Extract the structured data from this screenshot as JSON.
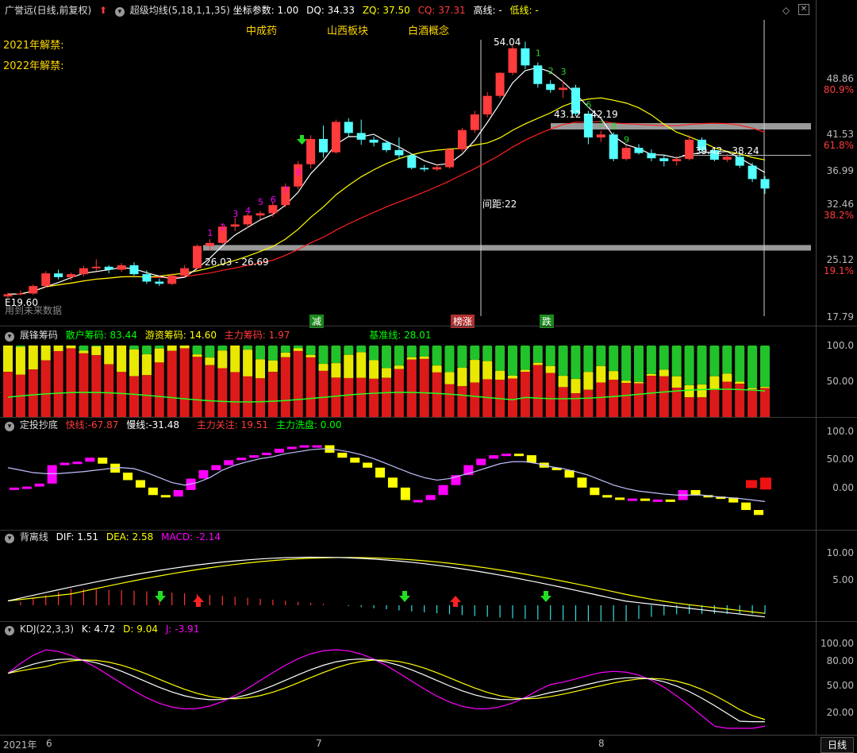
{
  "panel_main": {
    "title": "广誉远(日线,前复权)",
    "indicator_name": "超级均线",
    "indicator_params": "(5,18,1,1,35)",
    "coord_label": "坐标参数:",
    "coord_val": "1.00",
    "dq_label": "DQ:",
    "dq_val": "34.33",
    "zq_label": "ZQ:",
    "zq_val": "37.50",
    "cq_label": "CQ:",
    "cq_val": "37.31",
    "high_label": "高线:",
    "high_val": "-",
    "low_label": "低线:",
    "low_val": "-",
    "concepts": [
      "中成药",
      "山西板块",
      "白酒概念"
    ],
    "unlock_2021": "2021年解禁:",
    "unlock_2022": "2022年解禁:",
    "annot_peak": "54.04",
    "annot_band1": "43.12 - 42.19",
    "annot_band2": "39.42 - 38.24",
    "annot_band3": "26.03 - 26.69",
    "annot_low": "19.60",
    "annot_spacing": "间距:22",
    "annot_future": "用到未来数据",
    "tag_reduce": "减",
    "tag_list": "榜涨",
    "tag_fall": "跌",
    "yticks": [
      "48.86",
      "80.9%",
      "41.53",
      "61.8%",
      "36.99",
      "32.46",
      "38.2%",
      "25.12",
      "19.1%",
      "17.79"
    ]
  },
  "panel_chip": {
    "title": "展锋筹码",
    "retail_label": "散户筹码:",
    "retail_val": "83.44",
    "hot_label": "游资筹码:",
    "hot_val": "14.60",
    "main_label": "主力筹码:",
    "main_val": "1.97",
    "base_label": "基准线:",
    "base_val": "28.01",
    "yticks": [
      "100.0",
      "50.00"
    ]
  },
  "panel_dt": {
    "title": "定投抄底",
    "fast_label": "快线:",
    "fast_val": "-67.87",
    "slow_label": "慢线:",
    "slow_val": "-31.48",
    "focus_label": "主力关注:",
    "focus_val": "19.51",
    "wash_label": "主力洗盘:",
    "wash_val": "0.00",
    "yticks": [
      "100.0",
      "50.00",
      "0.00"
    ]
  },
  "panel_macd": {
    "title": "背离线",
    "dif_label": "DIF:",
    "dif_val": "1.51",
    "dea_label": "DEA:",
    "dea_val": "2.58",
    "macd_label": "MACD:",
    "macd_val": "-2.14",
    "yticks": [
      "10.00",
      "5.00"
    ]
  },
  "panel_kdj": {
    "title": "KDJ(22,3,3)",
    "k_label": "K:",
    "k_val": "4.72",
    "d_label": "D:",
    "d_val": "9.04",
    "j_label": "J:",
    "j_val": "-3.91",
    "yticks": [
      "100.00",
      "80.00",
      "50.00",
      "20.00"
    ]
  },
  "xaxis": {
    "labels": [
      "2021年",
      "6",
      "7",
      "8"
    ],
    "period_button": "日线"
  },
  "colors": {
    "up": "#ff3b3b",
    "down": "#54ffff",
    "ma_fast": "#ffffff",
    "ma_mid": "#ffff00",
    "ma_slow": "#ff2020",
    "purple": "#ff00ff",
    "green": "#00ff00"
  },
  "chart_data": {
    "type": "candlestick",
    "note_series": [
      "close",
      "ma_fast",
      "ma_mid",
      "ma_slow"
    ],
    "x": [
      "d1",
      "d2",
      "d3",
      "d4",
      "d5",
      "d6",
      "d7",
      "d8",
      "d9",
      "d10",
      "d11",
      "d12",
      "d13",
      "d14",
      "d15",
      "d16",
      "d17",
      "d18",
      "d19",
      "d20",
      "d21",
      "d22",
      "d23",
      "d24",
      "d25",
      "d26",
      "d27",
      "d28",
      "d29",
      "d30",
      "d31",
      "d32",
      "d33",
      "d34",
      "d35",
      "d36",
      "d37",
      "d38",
      "d39",
      "d40",
      "d41",
      "d42",
      "d43",
      "d44",
      "d45",
      "d46",
      "d47",
      "d48",
      "d49",
      "d50",
      "d51",
      "d52",
      "d53",
      "d54",
      "d55",
      "d56",
      "d57",
      "d58",
      "d59",
      "d60",
      "d61"
    ],
    "ohlc": [
      [
        19.8,
        20.3,
        19.6,
        20.1
      ],
      [
        20.1,
        20.6,
        19.9,
        20.2
      ],
      [
        20.2,
        21.4,
        20.0,
        21.2
      ],
      [
        21.2,
        23.2,
        21.0,
        22.9
      ],
      [
        22.9,
        23.4,
        22.1,
        22.4
      ],
      [
        22.4,
        23.0,
        22.0,
        22.8
      ],
      [
        22.8,
        23.9,
        22.5,
        23.6
      ],
      [
        23.6,
        24.8,
        23.2,
        23.8
      ],
      [
        23.8,
        24.0,
        22.9,
        23.4
      ],
      [
        23.4,
        24.3,
        23.1,
        24.0
      ],
      [
        24.0,
        24.4,
        22.6,
        22.8
      ],
      [
        22.8,
        23.3,
        21.5,
        21.8
      ],
      [
        21.8,
        22.2,
        21.2,
        21.5
      ],
      [
        21.5,
        22.9,
        21.3,
        22.6
      ],
      [
        22.6,
        24.0,
        22.4,
        23.6
      ],
      [
        23.6,
        26.8,
        23.5,
        26.6
      ],
      [
        26.6,
        27.5,
        26.0,
        27.0
      ],
      [
        27.0,
        29.5,
        26.8,
        29.2
      ],
      [
        29.2,
        30.4,
        28.6,
        29.5
      ],
      [
        29.5,
        31.0,
        29.0,
        30.7
      ],
      [
        30.7,
        31.3,
        30.2,
        31.0
      ],
      [
        31.0,
        32.5,
        30.5,
        32.1
      ],
      [
        32.1,
        35.0,
        31.8,
        34.6
      ],
      [
        34.6,
        38.0,
        34.2,
        37.6
      ],
      [
        37.6,
        41.5,
        37.0,
        41.0
      ],
      [
        41.0,
        42.8,
        38.5,
        39.2
      ],
      [
        39.2,
        43.6,
        39.0,
        43.3
      ],
      [
        43.3,
        43.8,
        41.2,
        41.8
      ],
      [
        41.8,
        43.6,
        40.2,
        40.9
      ],
      [
        40.9,
        41.3,
        40.0,
        40.5
      ],
      [
        40.5,
        40.8,
        39.2,
        39.5
      ],
      [
        39.5,
        41.2,
        38.4,
        38.8
      ],
      [
        38.8,
        39.0,
        36.9,
        37.1
      ],
      [
        37.1,
        37.5,
        36.6,
        36.9
      ],
      [
        36.9,
        37.6,
        36.7,
        37.2
      ],
      [
        37.2,
        39.8,
        37.0,
        39.6
      ],
      [
        39.6,
        42.5,
        39.3,
        42.2
      ],
      [
        42.2,
        44.8,
        41.8,
        44.3
      ],
      [
        44.3,
        47.3,
        43.9,
        46.8
      ],
      [
        46.8,
        50.0,
        46.5,
        49.9
      ],
      [
        49.9,
        53.6,
        49.6,
        53.2
      ],
      [
        53.2,
        54.1,
        50.4,
        50.9
      ],
      [
        50.9,
        51.3,
        47.9,
        48.4
      ],
      [
        48.4,
        48.9,
        47.2,
        47.6
      ],
      [
        47.6,
        48.8,
        46.5,
        47.9
      ],
      [
        47.9,
        48.3,
        44.1,
        44.4
      ],
      [
        44.4,
        44.8,
        40.3,
        41.2
      ],
      [
        41.2,
        42.1,
        40.6,
        41.6
      ],
      [
        41.6,
        41.9,
        38.0,
        38.3
      ],
      [
        38.3,
        40.1,
        38.1,
        39.8
      ],
      [
        39.8,
        40.3,
        38.9,
        39.1
      ],
      [
        39.1,
        39.6,
        38.0,
        38.4
      ],
      [
        38.4,
        38.9,
        37.3,
        38.0
      ],
      [
        38.0,
        38.7,
        37.4,
        38.3
      ],
      [
        38.3,
        41.5,
        38.1,
        40.9
      ],
      [
        40.9,
        41.2,
        39.2,
        39.5
      ],
      [
        39.5,
        39.9,
        38.0,
        38.2
      ],
      [
        38.2,
        39.0,
        37.9,
        38.6
      ],
      [
        38.6,
        39.2,
        37.1,
        37.4
      ],
      [
        37.4,
        37.8,
        35.2,
        35.6
      ],
      [
        35.6,
        36.0,
        33.6,
        34.33
      ]
    ],
    "ylim": [
      17.79,
      55
    ]
  }
}
